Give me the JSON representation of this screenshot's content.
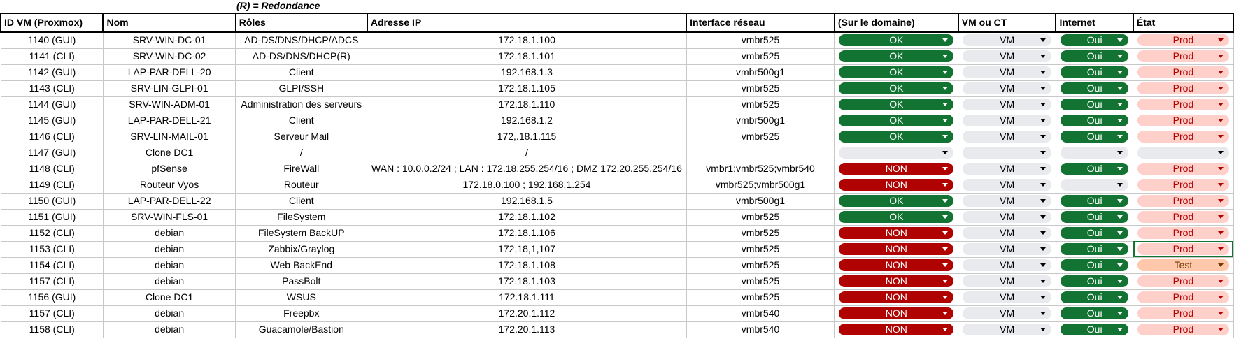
{
  "note": "(R) = Redondance",
  "columns": [
    "ID VM (Proxmox)",
    "Nom",
    "Rôles",
    "Adresse IP",
    "Interface réseau",
    "(Sur le domaine)",
    "VM ou CT",
    "Internet",
    "État"
  ],
  "rows": [
    {
      "id": "1140 (GUI)",
      "nom": "SRV-WIN-DC-01",
      "role": "AD-DS/DNS/DHCP/ADCS",
      "ip": "172.18.1.100",
      "iface": "vmbr525",
      "domaine": "OK",
      "type": "VM",
      "internet": "Oui",
      "etat": "Prod"
    },
    {
      "id": "1141 (CLI)",
      "nom": "SRV-WIN-DC-02",
      "role": "AD-DS/DNS/DHCP(R)",
      "ip": "172.18.1.101",
      "iface": "vmbr525",
      "domaine": "OK",
      "type": "VM",
      "internet": "Oui",
      "etat": "Prod"
    },
    {
      "id": "1142 (GUI)",
      "nom": "LAP-PAR-DELL-20",
      "role": "Client",
      "ip": "192.168.1.3",
      "iface": "vmbr500g1",
      "domaine": "OK",
      "type": "VM",
      "internet": "Oui",
      "etat": "Prod"
    },
    {
      "id": "1143 (CLI)",
      "nom": "SRV-LIN-GLPI-01",
      "role": "GLPI/SSH",
      "ip": "172.18.1.105",
      "iface": "vmbr525",
      "domaine": "OK",
      "type": "VM",
      "internet": "Oui",
      "etat": "Prod"
    },
    {
      "id": "1144 (GUI)",
      "nom": "SRV-WIN-ADM-01",
      "role": "Administration des serveurs",
      "ip": "172.18.1.110",
      "iface": "vmbr525",
      "domaine": "OK",
      "type": "VM",
      "internet": "Oui",
      "etat": "Prod"
    },
    {
      "id": "1145 (GUI)",
      "nom": "LAP-PAR-DELL-21",
      "role": "Client",
      "ip": "192.168.1.2",
      "iface": "vmbr500g1",
      "domaine": "OK",
      "type": "VM",
      "internet": "Oui",
      "etat": "Prod"
    },
    {
      "id": "1146 (CLI)",
      "nom": "SRV-LIN-MAIL-01",
      "role": "Serveur Mail",
      "ip": "172,.18.1.115",
      "iface": "vmbr525",
      "domaine": "OK",
      "type": "VM",
      "internet": "Oui",
      "etat": "Prod"
    },
    {
      "id": "1147 (GUI)",
      "nom": "Clone DC1",
      "role": "/",
      "ip": "/",
      "iface": "",
      "domaine": "",
      "type": "",
      "internet": "",
      "etat": ""
    },
    {
      "id": "1148 (CLI)",
      "nom": "pfSense",
      "role": "FireWall",
      "ip": "WAN : 10.0.0.2/24 ; LAN : 172.18.255.254/16 ; DMZ 172.20.255.254/16",
      "iface": "vmbr1;vmbr525;vmbr540",
      "domaine": "NON",
      "type": "VM",
      "internet": "Oui",
      "etat": "Prod"
    },
    {
      "id": "1149 (CLI)",
      "nom": "Routeur Vyos",
      "role": "Routeur",
      "ip": "172.18.0.100 ; 192.168.1.254",
      "iface": "vmbr525;vmbr500g1",
      "domaine": "NON",
      "type": "VM",
      "internet": "",
      "etat": "Prod"
    },
    {
      "id": "1150 (GUI)",
      "nom": "LAP-PAR-DELL-22",
      "role": "Client",
      "ip": "192.168.1.5",
      "iface": "vmbr500g1",
      "domaine": "OK",
      "type": "VM",
      "internet": "Oui",
      "etat": "Prod"
    },
    {
      "id": "1151 (GUI)",
      "nom": "SRV-WIN-FLS-01",
      "role": "FileSystem",
      "ip": "172.18.1.102",
      "iface": "vmbr525",
      "domaine": "OK",
      "type": "VM",
      "internet": "Oui",
      "etat": "Prod"
    },
    {
      "id": "1152 (CLI)",
      "nom": "debian",
      "role": "FileSystem BackUP",
      "ip": "172.18.1.106",
      "iface": "vmbr525",
      "domaine": "NON",
      "type": "VM",
      "internet": "Oui",
      "etat": "Prod"
    },
    {
      "id": "1153 (CLI)",
      "nom": "debian",
      "role": "Zabbix/Graylog",
      "ip": "172,18,1,107",
      "iface": "vmbr525",
      "domaine": "NON",
      "type": "VM",
      "internet": "Oui",
      "etat": "Prod"
    },
    {
      "id": "1154 (CLI)",
      "nom": "debian",
      "role": "Web BackEnd",
      "ip": "172.18.1.108",
      "iface": "vmbr525",
      "domaine": "NON",
      "type": "VM",
      "internet": "Oui",
      "etat": "Test"
    },
    {
      "id": "1157 (CLI)",
      "nom": "debian",
      "role": "PassBolt",
      "ip": "172.18.1.103",
      "iface": "vmbr525",
      "domaine": "NON",
      "type": "VM",
      "internet": "Oui",
      "etat": "Prod"
    },
    {
      "id": "1156 (GUI)",
      "nom": "Clone DC1",
      "role": "WSUS",
      "ip": "172.18.1.111",
      "iface": "vmbr525",
      "domaine": "NON",
      "type": "VM",
      "internet": "Oui",
      "etat": "Prod"
    },
    {
      "id": "1157 (CLI)",
      "nom": "debian",
      "role": "Freepbx",
      "ip": "172.20.1.112",
      "iface": "vmbr540",
      "domaine": "NON",
      "type": "VM",
      "internet": "Oui",
      "etat": "Prod"
    },
    {
      "id": "1158 (CLI)",
      "nom": "debian",
      "role": "Guacamole/Bastion",
      "ip": "172.20.1.113",
      "iface": "vmbr540",
      "domaine": "NON",
      "type": "VM",
      "internet": "Oui",
      "etat": "Prod"
    }
  ],
  "colors": {
    "ok_bg": "#137333",
    "non_bg": "#b10202",
    "neutral_bg": "#e8eaed",
    "prod_bg": "#ffcfc9",
    "prod_fg": "#b10202",
    "test_bg": "#ffc8aa",
    "test_fg": "#753800",
    "selection": "#137333"
  },
  "icons": {
    "dropdown": "chevron-down-icon"
  }
}
